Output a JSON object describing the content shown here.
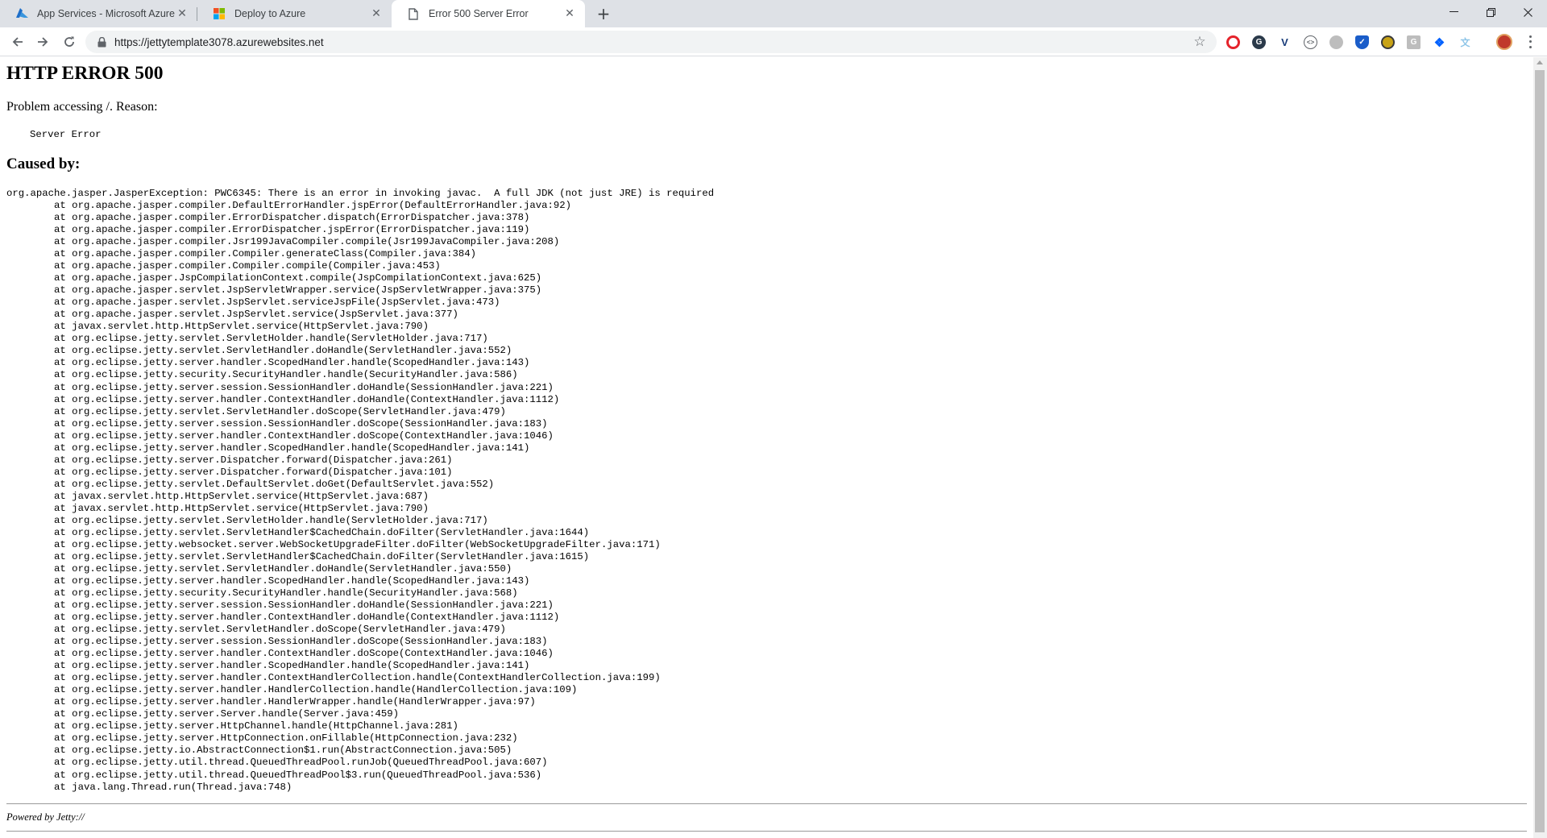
{
  "browser": {
    "tabs": [
      {
        "title": "App Services - Microsoft Azure",
        "icon": "azure-icon",
        "active": false
      },
      {
        "title": "Deploy to Azure",
        "icon": "microsoft-icon",
        "active": false
      },
      {
        "title": "Error 500 Server Error",
        "icon": "document-icon",
        "active": true
      }
    ],
    "url": "https://jettytemplate3078.azurewebsites.net",
    "extensions": [
      {
        "name": "opera-icon",
        "color": "#e5232b",
        "glyph": "O"
      },
      {
        "name": "ghostery-icon",
        "color": "#2b3a4a",
        "glyph": "G"
      },
      {
        "name": "vimeo-icon",
        "color": "#1a3d7a",
        "glyph": "V"
      },
      {
        "name": "code-icon",
        "color": "#5f6368",
        "glyph": "<>"
      },
      {
        "name": "circle-icon",
        "color": "#9e9e9e",
        "glyph": ""
      },
      {
        "name": "shield-icon",
        "color": "#1a5dc9",
        "glyph": "✓"
      },
      {
        "name": "coin-icon",
        "color": "#c8a316",
        "glyph": ""
      },
      {
        "name": "g-icon",
        "color": "#9e9e9e",
        "glyph": "G"
      },
      {
        "name": "dropbox-icon",
        "color": "#0061fe",
        "glyph": "❖"
      },
      {
        "name": "translate-icon",
        "color": "#8ec5e8",
        "glyph": "文"
      },
      {
        "name": "profile-avatar",
        "color": "#c0392b",
        "glyph": ""
      }
    ]
  },
  "page": {
    "heading": "HTTP ERROR 500",
    "problem_prefix": "Problem accessing ",
    "problem_path": "/",
    "problem_suffix": ". Reason:",
    "reason": "Server Error",
    "caused_by": "Caused by:",
    "stack_trace": "org.apache.jasper.JasperException: PWC6345: There is an error in invoking javac.  A full JDK (not just JRE) is required\n\tat org.apache.jasper.compiler.DefaultErrorHandler.jspError(DefaultErrorHandler.java:92)\n\tat org.apache.jasper.compiler.ErrorDispatcher.dispatch(ErrorDispatcher.java:378)\n\tat org.apache.jasper.compiler.ErrorDispatcher.jspError(ErrorDispatcher.java:119)\n\tat org.apache.jasper.compiler.Jsr199JavaCompiler.compile(Jsr199JavaCompiler.java:208)\n\tat org.apache.jasper.compiler.Compiler.generateClass(Compiler.java:384)\n\tat org.apache.jasper.compiler.Compiler.compile(Compiler.java:453)\n\tat org.apache.jasper.JspCompilationContext.compile(JspCompilationContext.java:625)\n\tat org.apache.jasper.servlet.JspServletWrapper.service(JspServletWrapper.java:375)\n\tat org.apache.jasper.servlet.JspServlet.serviceJspFile(JspServlet.java:473)\n\tat org.apache.jasper.servlet.JspServlet.service(JspServlet.java:377)\n\tat javax.servlet.http.HttpServlet.service(HttpServlet.java:790)\n\tat org.eclipse.jetty.servlet.ServletHolder.handle(ServletHolder.java:717)\n\tat org.eclipse.jetty.servlet.ServletHandler.doHandle(ServletHandler.java:552)\n\tat org.eclipse.jetty.server.handler.ScopedHandler.handle(ScopedHandler.java:143)\n\tat org.eclipse.jetty.security.SecurityHandler.handle(SecurityHandler.java:586)\n\tat org.eclipse.jetty.server.session.SessionHandler.doHandle(SessionHandler.java:221)\n\tat org.eclipse.jetty.server.handler.ContextHandler.doHandle(ContextHandler.java:1112)\n\tat org.eclipse.jetty.servlet.ServletHandler.doScope(ServletHandler.java:479)\n\tat org.eclipse.jetty.server.session.SessionHandler.doScope(SessionHandler.java:183)\n\tat org.eclipse.jetty.server.handler.ContextHandler.doScope(ContextHandler.java:1046)\n\tat org.eclipse.jetty.server.handler.ScopedHandler.handle(ScopedHandler.java:141)\n\tat org.eclipse.jetty.server.Dispatcher.forward(Dispatcher.java:261)\n\tat org.eclipse.jetty.server.Dispatcher.forward(Dispatcher.java:101)\n\tat org.eclipse.jetty.servlet.DefaultServlet.doGet(DefaultServlet.java:552)\n\tat javax.servlet.http.HttpServlet.service(HttpServlet.java:687)\n\tat javax.servlet.http.HttpServlet.service(HttpServlet.java:790)\n\tat org.eclipse.jetty.servlet.ServletHolder.handle(ServletHolder.java:717)\n\tat org.eclipse.jetty.servlet.ServletHandler$CachedChain.doFilter(ServletHandler.java:1644)\n\tat org.eclipse.jetty.websocket.server.WebSocketUpgradeFilter.doFilter(WebSocketUpgradeFilter.java:171)\n\tat org.eclipse.jetty.servlet.ServletHandler$CachedChain.doFilter(ServletHandler.java:1615)\n\tat org.eclipse.jetty.servlet.ServletHandler.doHandle(ServletHandler.java:550)\n\tat org.eclipse.jetty.server.handler.ScopedHandler.handle(ScopedHandler.java:143)\n\tat org.eclipse.jetty.security.SecurityHandler.handle(SecurityHandler.java:568)\n\tat org.eclipse.jetty.server.session.SessionHandler.doHandle(SessionHandler.java:221)\n\tat org.eclipse.jetty.server.handler.ContextHandler.doHandle(ContextHandler.java:1112)\n\tat org.eclipse.jetty.servlet.ServletHandler.doScope(ServletHandler.java:479)\n\tat org.eclipse.jetty.server.session.SessionHandler.doScope(SessionHandler.java:183)\n\tat org.eclipse.jetty.server.handler.ContextHandler.doScope(ContextHandler.java:1046)\n\tat org.eclipse.jetty.server.handler.ScopedHandler.handle(ScopedHandler.java:141)\n\tat org.eclipse.jetty.server.handler.ContextHandlerCollection.handle(ContextHandlerCollection.java:199)\n\tat org.eclipse.jetty.server.handler.HandlerCollection.handle(HandlerCollection.java:109)\n\tat org.eclipse.jetty.server.handler.HandlerWrapper.handle(HandlerWrapper.java:97)\n\tat org.eclipse.jetty.server.Server.handle(Server.java:459)\n\tat org.eclipse.jetty.server.HttpChannel.handle(HttpChannel.java:281)\n\tat org.eclipse.jetty.server.HttpConnection.onFillable(HttpConnection.java:232)\n\tat org.eclipse.jetty.io.AbstractConnection$1.run(AbstractConnection.java:505)\n\tat org.eclipse.jetty.util.thread.QueuedThreadPool.runJob(QueuedThreadPool.java:607)\n\tat org.eclipse.jetty.util.thread.QueuedThreadPool$3.run(QueuedThreadPool.java:536)\n\tat java.lang.Thread.run(Thread.java:748)",
    "powered_by_prefix": "Powered by ",
    "powered_by_link": "Jetty://"
  }
}
